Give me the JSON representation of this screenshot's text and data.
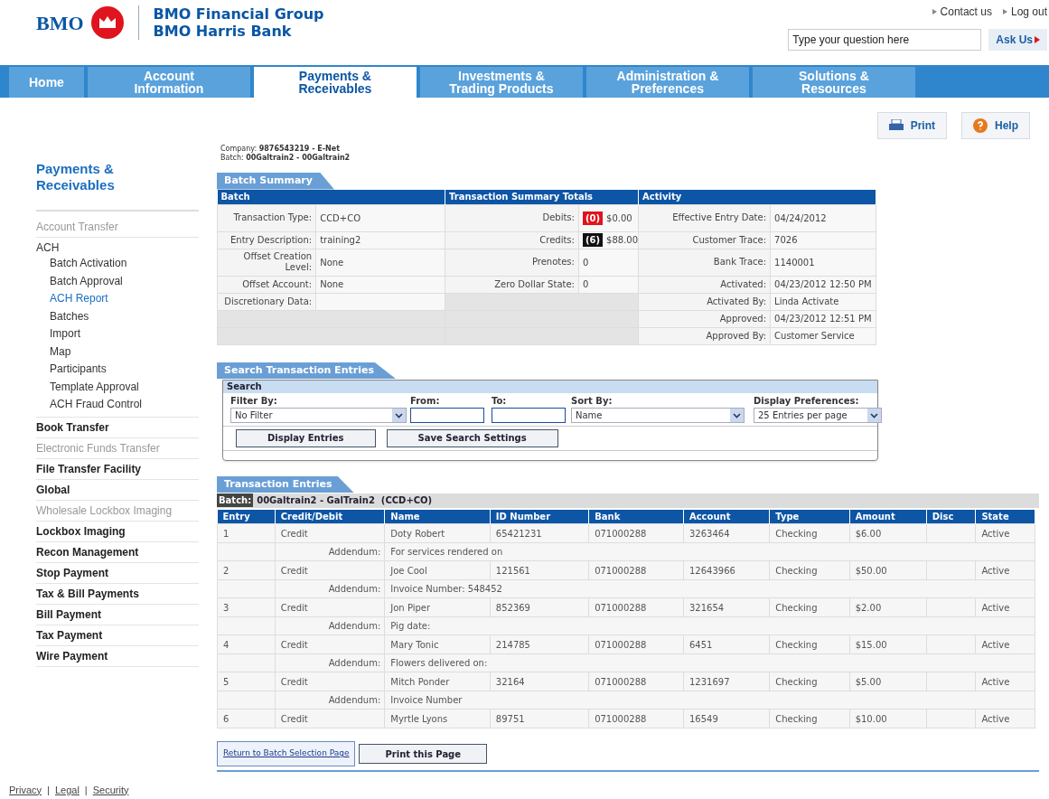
{
  "header": {
    "logo_text": "BMO",
    "brand": [
      "BMO Financial Group",
      "BMO Harris Bank"
    ],
    "top_links": [
      "Contact us",
      "Log out"
    ],
    "question": {
      "placeholder": "Type your question here"
    },
    "ask_button": "Ask Us"
  },
  "nav": [
    {
      "label": "Home",
      "selected": false
    },
    {
      "label": "Account Information",
      "selected": false
    },
    {
      "label": "Payments & Receivables",
      "selected": true
    },
    {
      "label": "Investments & Trading Products",
      "selected": false
    },
    {
      "label": "Administration & Preferences",
      "selected": false
    },
    {
      "label": "Solutions & Resources",
      "selected": false
    }
  ],
  "tools": [
    {
      "label": "Print",
      "kind": "print"
    },
    {
      "label": "Help",
      "kind": "help"
    }
  ],
  "sidebar": {
    "title": "Payments & Receivables",
    "items": [
      {
        "label": "Account Transfer",
        "disabled": true
      },
      {
        "label": "ACH",
        "disabled": false,
        "children": [
          {
            "label": "Batch Activation",
            "selected": false
          },
          {
            "label": "Batch Approval",
            "selected": false
          },
          {
            "label": "ACH Report",
            "selected": true
          },
          {
            "label": "Batches",
            "selected": false
          },
          {
            "label": "Import",
            "selected": false
          },
          {
            "label": "Map",
            "selected": false
          },
          {
            "label": "Participants",
            "selected": false
          },
          {
            "label": "Template Approval",
            "selected": false
          },
          {
            "label": "ACH Fraud Control",
            "selected": false
          }
        ]
      },
      {
        "label": "Book Transfer",
        "disabled": false
      },
      {
        "label": "Electronic Funds Transfer",
        "disabled": true
      },
      {
        "label": "File Transfer Facility",
        "disabled": false
      },
      {
        "label": "Global",
        "disabled": false
      },
      {
        "label": "Wholesale Lockbox Imaging",
        "disabled": true
      },
      {
        "label": "Lockbox Imaging",
        "disabled": false
      },
      {
        "label": "Recon Management",
        "disabled": false
      },
      {
        "label": "Stop Payment",
        "disabled": false
      },
      {
        "label": "Tax & Bill Payments",
        "disabled": false
      },
      {
        "label": "Bill Payment",
        "disabled": false
      },
      {
        "label": "Tax Payment",
        "disabled": false
      },
      {
        "label": "Wire Payment",
        "disabled": false
      }
    ]
  },
  "context": [
    "Company: **9876543219 - E-Net**",
    "Batch: **00Galtrain2 - 00Galtrain2**"
  ],
  "batch_summary": {
    "tab": "Batch Summary",
    "columns": [
      {
        "title": "Batch",
        "rows": [
          {
            "label": "Transaction Type:",
            "value": "CCD+CO"
          },
          {
            "label": "Entry Description:",
            "value": "training2"
          },
          {
            "label": "Offset Creation Level:",
            "value": "None"
          },
          {
            "label": "Offset Account:",
            "value": "None"
          },
          {
            "label": "Discretionary Data:"
          }
        ]
      },
      {
        "title": "Transaction Summary Totals",
        "rows": [
          {
            "label": "Debits:",
            "badge": "(0)",
            "color": "#e0141e",
            "value": "$0.00"
          },
          {
            "label": "Credits:",
            "badge": "(6)",
            "color": "#111111",
            "value": "$88.00"
          },
          {
            "label": "Prenotes:",
            "value": "0"
          },
          {
            "label": "Zero Dollar State:",
            "value": "0"
          }
        ]
      },
      {
        "title": "Activity",
        "rows": [
          {
            "label": "Effective Entry Date:",
            "value": "04/24/2012"
          },
          {
            "label": "Customer Trace:",
            "value": "7026"
          },
          {
            "label": "Bank Trace:",
            "value": "1140001"
          },
          {
            "label": "Activated:",
            "value": "04/23/2012 12:50 PM"
          },
          {
            "label": "Activated By:",
            "value": "Linda Activate"
          },
          {
            "label": "Approved:",
            "value": "04/23/2012 12:51 PM"
          },
          {
            "label": "Approved By:",
            "value": "Customer Service"
          }
        ]
      }
    ]
  },
  "search": {
    "tab": "Search Transaction Entries",
    "title": "Search",
    "filter": {
      "label": "Filter By:",
      "value": "No Filter"
    },
    "from": {
      "label": "From:"
    },
    "to": {
      "label": "To:"
    },
    "sort": {
      "label": "Sort By:",
      "value": "Name"
    },
    "display": {
      "label": "Display Preferences:",
      "value": "25 Entries per page"
    },
    "buttons": [
      "Display Entries",
      "Save Search Settings"
    ]
  },
  "entries": {
    "tab": "Transaction Entries",
    "batch_label": "Batch:",
    "batch_value": "00Galtrain2 - GalTrain2  (CCD+CO)",
    "columns": [
      "Entry",
      "Credit/Debit",
      "Name",
      "ID Number",
      "Bank",
      "Account",
      "Type",
      "Amount",
      "Disc",
      "State"
    ],
    "rows": [
      {
        "entry": "1",
        "credit_debit": "Credit",
        "name": "Doty Robert",
        "id": "65421231",
        "bank": "071000288",
        "account": "3263464",
        "type": "Checking",
        "amount": "$6.00",
        "state": "Active",
        "addendum_label": "Addendum:",
        "addendum": "For services rendered on"
      },
      {
        "entry": "2",
        "credit_debit": "Credit",
        "name": "Joe Cool",
        "id": "121561",
        "bank": "071000288",
        "account": "12643966",
        "type": "Checking",
        "amount": "$50.00",
        "state": "Active",
        "addendum_label": "Addendum:",
        "addendum": "Invoice Number: 548452"
      },
      {
        "entry": "3",
        "credit_debit": "Credit",
        "name": "Jon Piper",
        "id": "852369",
        "bank": "071000288",
        "account": "321654",
        "type": "Checking",
        "amount": "$2.00",
        "state": "Active",
        "addendum_label": "Addendum:",
        "addendum": "Pig date:"
      },
      {
        "entry": "4",
        "credit_debit": "Credit",
        "name": "Mary Tonic",
        "id": "214785",
        "bank": "071000288",
        "account": "6451",
        "type": "Checking",
        "amount": "$15.00",
        "state": "Active",
        "addendum_label": "Addendum:",
        "addendum": "Flowers delivered on:"
      },
      {
        "entry": "5",
        "credit_debit": "Credit",
        "name": "Mitch Ponder",
        "id": "32164",
        "bank": "071000288",
        "account": "1231697",
        "type": "Checking",
        "amount": "$5.00",
        "state": "Active",
        "addendum_label": "Addendum:",
        "addendum": "Invoice Number"
      },
      {
        "entry": "6",
        "credit_debit": "Credit",
        "name": "Myrtle Lyons",
        "id": "89751",
        "bank": "071000288",
        "account": "16549",
        "type": "Checking",
        "amount": "$10.00",
        "state": "Active"
      }
    ],
    "buttons": [
      {
        "label": "Return to Batch Selection Page",
        "kind": "link"
      },
      {
        "label": "Print this Page",
        "kind": "button"
      }
    ]
  },
  "footer": [
    {
      "kind": "link",
      "text": "Privacy"
    },
    {
      "kind": "separator",
      "text": "|"
    },
    {
      "kind": "link",
      "text": "Legal"
    },
    {
      "kind": "separator",
      "text": "|"
    },
    {
      "kind": "link",
      "text": "Security"
    }
  ]
}
